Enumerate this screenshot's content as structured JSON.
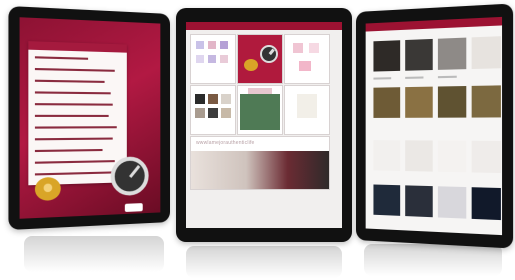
{
  "scene": "three tablets displaying an app",
  "colors": {
    "accent": "#a0173c",
    "frame": "#111111",
    "background": "#ffffff"
  },
  "center_tablet": {
    "banner_text": "wwwlamejorauthenticlife"
  },
  "icons": [
    "clock-icon",
    "character-icon"
  ]
}
